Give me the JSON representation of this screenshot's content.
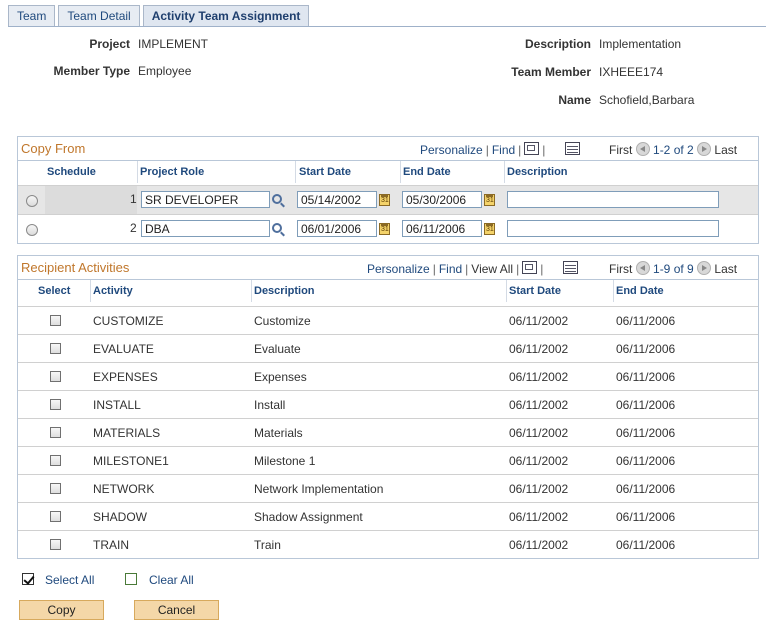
{
  "tabs": [
    {
      "label": "Team",
      "active": false
    },
    {
      "label": "Team Detail",
      "active": false
    },
    {
      "label": "Activity Team Assignment",
      "active": true
    }
  ],
  "header": {
    "project_label": "Project",
    "project_value": "IMPLEMENT",
    "member_type_label": "Member Type",
    "member_type_value": "Employee",
    "description_label": "Description",
    "description_value": "Implementation",
    "team_member_label": "Team Member",
    "team_member_value": "IXHEEE174",
    "name_label": "Name",
    "name_value": "Schofield,Barbara"
  },
  "copy_from": {
    "title": "Copy From",
    "personalize": "Personalize",
    "find": "Find",
    "first": "First",
    "range": "1-2 of 2",
    "last": "Last",
    "columns": [
      "Schedule",
      "Project Role",
      "Start Date",
      "End Date",
      "Description"
    ],
    "rows": [
      {
        "schedule": "1",
        "role": "SR DEVELOPER",
        "start": "05/14/2002",
        "end": "05/30/2006",
        "description": ""
      },
      {
        "schedule": "2",
        "role": "DBA",
        "start": "06/01/2006",
        "end": "06/11/2006",
        "description": ""
      }
    ]
  },
  "recipient": {
    "title": "Recipient Activities",
    "personalize": "Personalize",
    "find": "Find",
    "view_all": "View All",
    "first": "First",
    "range": "1-9 of 9",
    "last": "Last",
    "columns": [
      "Select",
      "Activity",
      "Description",
      "Start Date",
      "End Date"
    ],
    "rows": [
      {
        "activity": "CUSTOMIZE",
        "description": "Customize",
        "start": "06/11/2002",
        "end": "06/11/2006"
      },
      {
        "activity": "EVALUATE",
        "description": "Evaluate",
        "start": "06/11/2002",
        "end": "06/11/2006"
      },
      {
        "activity": "EXPENSES",
        "description": "Expenses",
        "start": "06/11/2002",
        "end": "06/11/2006"
      },
      {
        "activity": "INSTALL",
        "description": "Install",
        "start": "06/11/2002",
        "end": "06/11/2006"
      },
      {
        "activity": "MATERIALS",
        "description": "Materials",
        "start": "06/11/2002",
        "end": "06/11/2006"
      },
      {
        "activity": "MILESTONE1",
        "description": "Milestone 1",
        "start": "06/11/2002",
        "end": "06/11/2006"
      },
      {
        "activity": "NETWORK",
        "description": "Network Implementation",
        "start": "06/11/2002",
        "end": "06/11/2006"
      },
      {
        "activity": "SHADOW",
        "description": "Shadow Assignment",
        "start": "06/11/2002",
        "end": "06/11/2006"
      },
      {
        "activity": "TRAIN",
        "description": "Train",
        "start": "06/11/2002",
        "end": "06/11/2006"
      }
    ]
  },
  "actions": {
    "select_all": "Select All",
    "clear_all": "Clear All",
    "copy": "Copy",
    "cancel": "Cancel"
  },
  "colors": {
    "link": "#1f497d",
    "grid_title": "#c0772c",
    "button_bg": "#f4d7a8"
  }
}
